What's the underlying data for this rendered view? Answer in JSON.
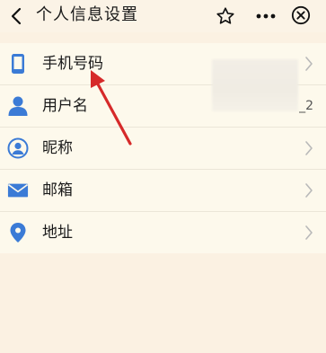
{
  "header": {
    "title": "个人信息设置",
    "back_icon": "chevron-left-icon",
    "star_icon": "star-outline-icon",
    "more_icon": "more-dots-icon",
    "close_icon": "close-circle-icon"
  },
  "colors": {
    "accent_blue": "#3b7bd6",
    "arrow_red": "#d62a2a",
    "background": "#fbf1e2",
    "list_background": "#fdf9ec"
  },
  "items": [
    {
      "label": "手机号码",
      "icon": "phone-icon",
      "value": ""
    },
    {
      "label": "用户名",
      "icon": "user-icon",
      "value": "_2"
    },
    {
      "label": "昵称",
      "icon": "nickname-icon",
      "value": ""
    },
    {
      "label": "邮箱",
      "icon": "email-icon",
      "value": ""
    },
    {
      "label": "地址",
      "icon": "location-pin-icon",
      "value": ""
    }
  ]
}
